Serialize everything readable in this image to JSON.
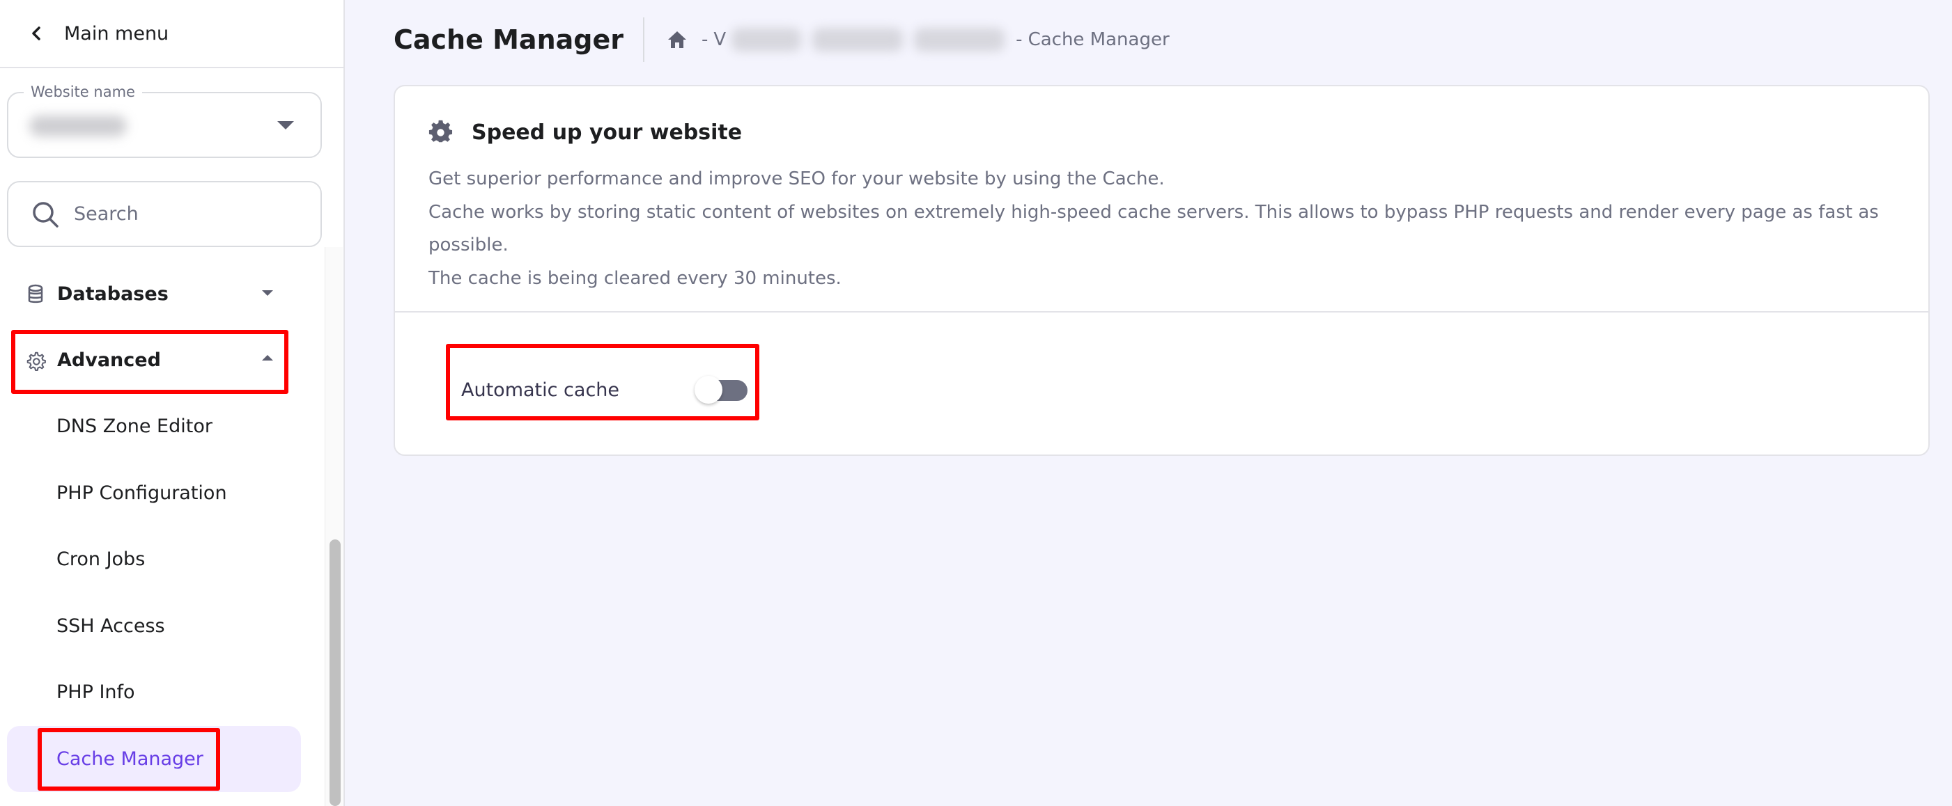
{
  "sidebar": {
    "main_menu_label": "Main menu",
    "website_field": {
      "label": "Website name",
      "value_redacted": true
    },
    "search": {
      "placeholder": "Search",
      "value": ""
    },
    "nav": {
      "databases": {
        "label": "Databases",
        "icon": "database-icon",
        "expanded": false
      },
      "advanced": {
        "label": "Advanced",
        "icon": "gear-outline-icon",
        "expanded": true
      },
      "advanced_items": [
        {
          "label": "DNS Zone Editor",
          "active": false
        },
        {
          "label": "PHP Configuration",
          "active": false
        },
        {
          "label": "Cron Jobs",
          "active": false
        },
        {
          "label": "SSH Access",
          "active": false
        },
        {
          "label": "PHP Info",
          "active": false
        },
        {
          "label": "Cache Manager",
          "active": true
        }
      ]
    }
  },
  "header": {
    "title": "Cache Manager",
    "breadcrumb": {
      "home_icon": "home-icon",
      "separator": "-",
      "first_char_visible": "V",
      "current": "Cache Manager"
    }
  },
  "card": {
    "title": "Speed up your website",
    "title_icon": "gear-icon",
    "description_lines": [
      "Get superior performance and improve SEO for your website by using the Cache.",
      "Cache works by storing static content of websites on extremely high-speed cache servers. This allows to bypass PHP requests and render every page as fast as possible.",
      "The cache is being cleared every 30 minutes."
    ],
    "automatic_cache": {
      "label": "Automatic cache",
      "enabled": false
    }
  },
  "colors": {
    "accent": "#673de6",
    "active_bg": "#f1ecff",
    "page_bg": "#f4f4fd",
    "annotation_red": "#ff0000",
    "toggle_off": "#6d7081"
  }
}
